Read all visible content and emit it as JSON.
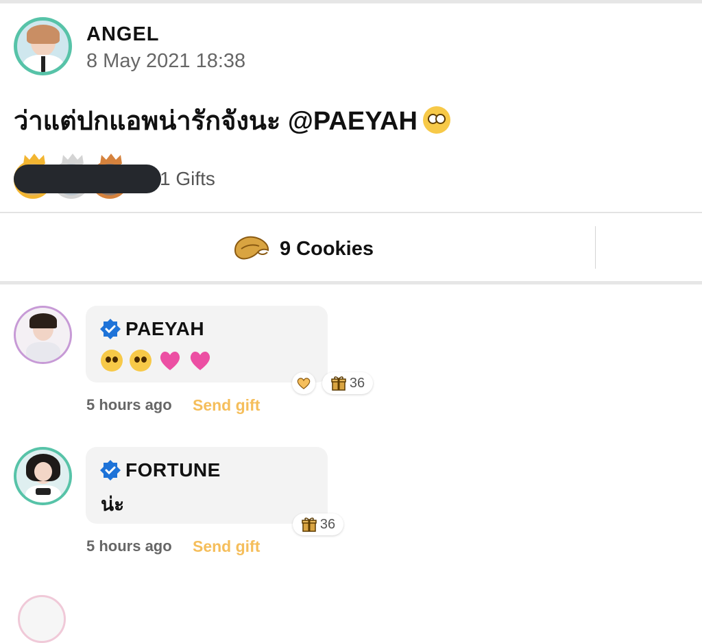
{
  "post": {
    "author": "ANGEL",
    "timestamp": "8 May 2021 18:38",
    "text": "ว่าแต่ปกแอพน่ารักจังนะ @PAEYAH",
    "emoji": "flushed-face",
    "gifts_label": "1 Gifts"
  },
  "actions": {
    "cookies_label": "9 Cookies",
    "cookie_icon": "fortune-cookie-icon"
  },
  "comments": [
    {
      "name": "PAEYAH",
      "verified": true,
      "text_emojis": [
        "pleading-face",
        "pleading-face",
        "sparkling-heart",
        "sparkling-heart"
      ],
      "heart_reaction": true,
      "gift_count": "36",
      "time": "5 hours ago",
      "send_gift": "Send gift"
    },
    {
      "name": "FORTUNE",
      "verified": true,
      "text": "น่ะ",
      "heart_reaction": false,
      "gift_count": "36",
      "time": "5 hours ago",
      "send_gift": "Send gift"
    }
  ],
  "colors": {
    "accent_gold": "#f5be5b",
    "verified_blue": "#1e73d8",
    "avatar_ring_teal": "#57c3a8",
    "avatar_ring_purple": "#c79ad6",
    "crown_gold": "#f2b531",
    "crown_silver": "#d4d4d4",
    "crown_bronze": "#d5823d"
  }
}
